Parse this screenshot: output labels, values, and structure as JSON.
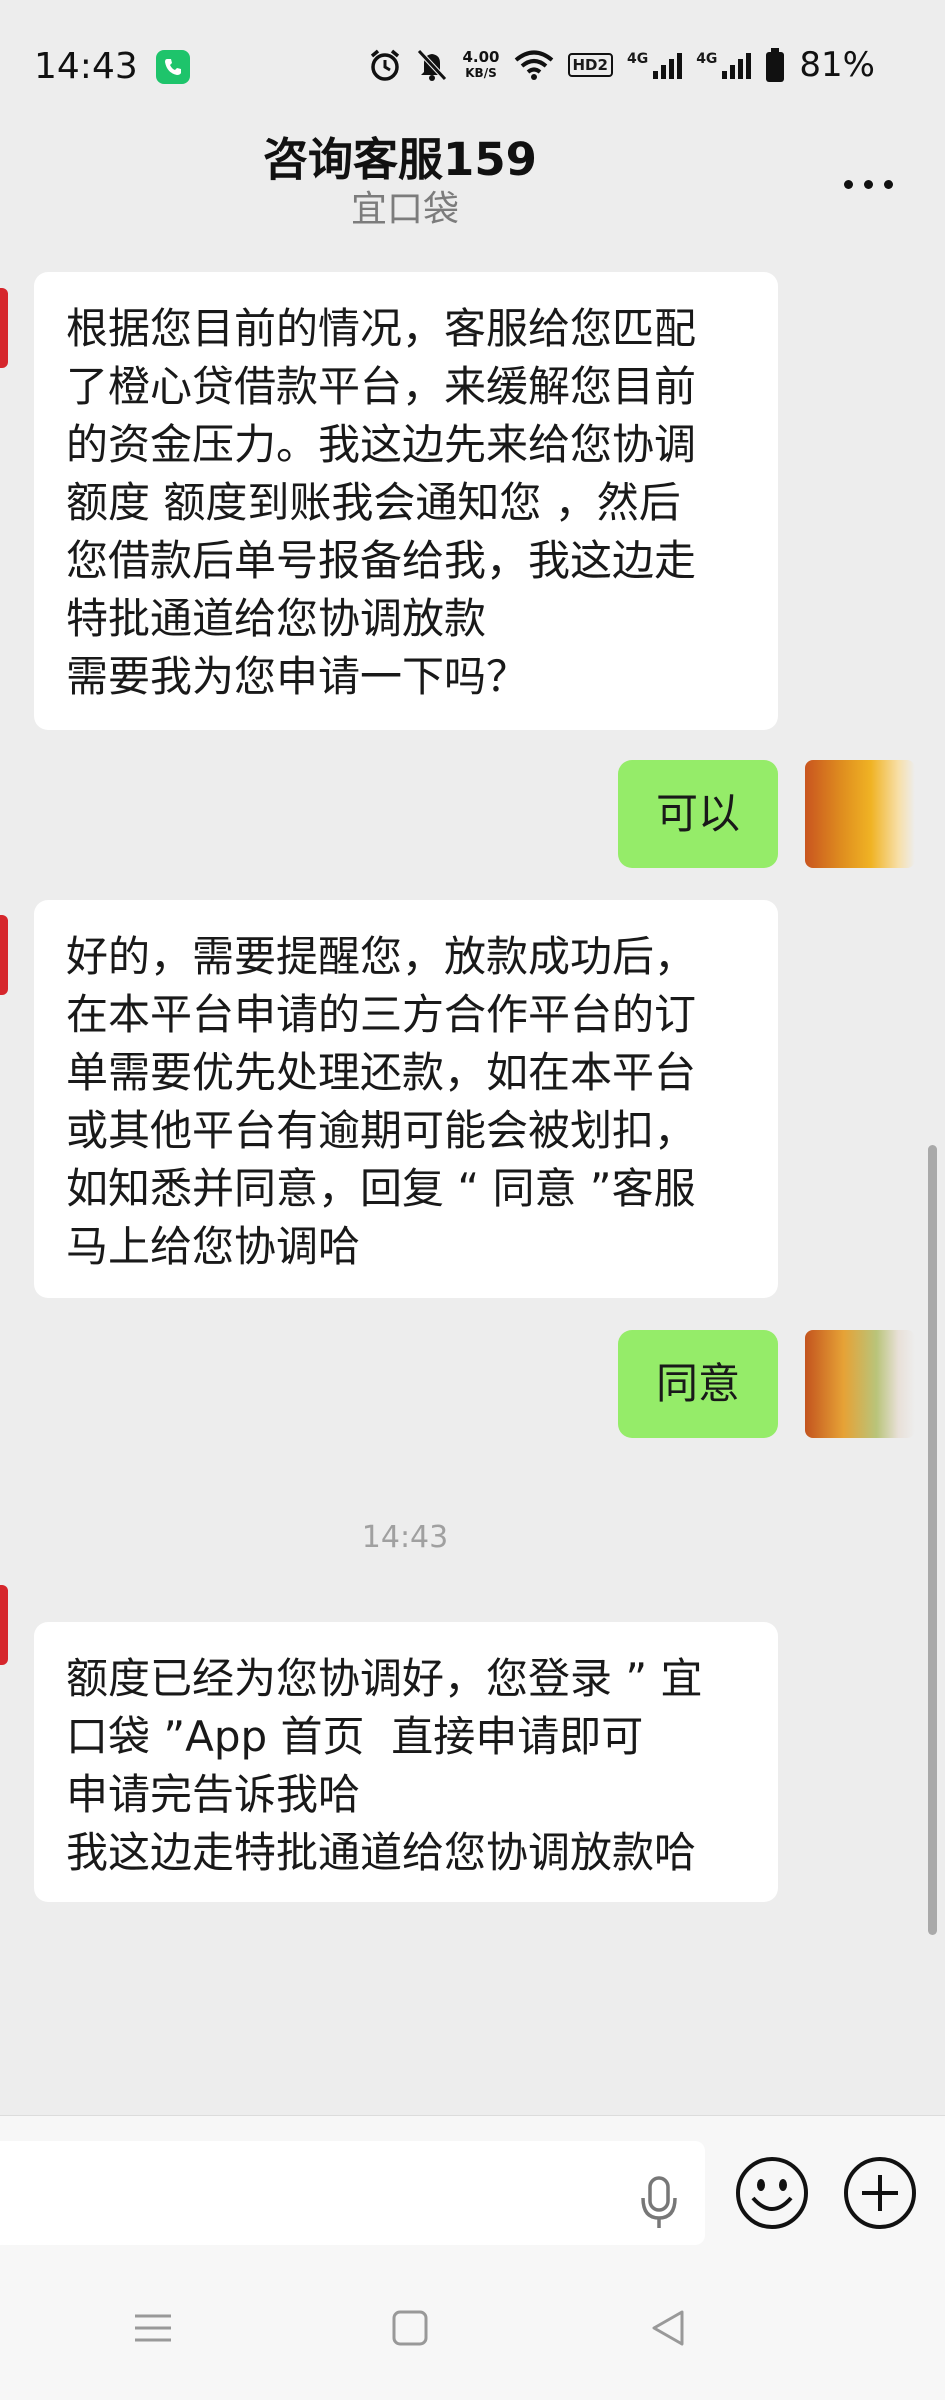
{
  "status_bar": {
    "time": "14:43",
    "speed_value": "4.00",
    "speed_unit": "KB/S",
    "hd": "HD2",
    "net1": "4G",
    "net2": "4G",
    "battery": "81%"
  },
  "header": {
    "title": "咨询客服159",
    "subtitle": "宜口袋"
  },
  "messages": [
    {
      "side": "left",
      "text": "根据您目前的情况，客服给您匹配\n了橙心贷借款平台，来缓解您目前\n的资金压力。我这边先来给您协调\n额度 额度到账我会通知您 ，然后\n您借款后单号报备给我，我这边走\n特批通道给您协调放款\n需要我为您申请一下吗？"
    },
    {
      "side": "right",
      "text": "可以"
    },
    {
      "side": "left",
      "text": "好的，需要提醒您，放款成功后，\n在本平台申请的三方合作平台的订\n单需要优先处理还款，如在本平台\n或其他平台有逾期可能会被划扣，\n如知悉并同意，回复 “ 同意 ”客服\n马上给您协调哈"
    },
    {
      "side": "right",
      "text": "同意"
    },
    {
      "side": "time",
      "text": "14:43"
    },
    {
      "side": "left",
      "text": "额度已经为您协调好，您登录 ” 宜\n口袋 ”App 首页  直接申请即可\n申请完告诉我哈\n我这边走特批通道给您协调放款哈"
    }
  ],
  "colors": {
    "background": "#ededed",
    "bubble_self": "#95ec69",
    "bubble_other": "#ffffff",
    "call_badge": "#1ec46b"
  },
  "icons": [
    "phone-icon",
    "alarm-icon",
    "mute-icon",
    "wifi-icon",
    "battery-icon",
    "more-icon",
    "mic-icon",
    "emoji-icon",
    "plus-icon",
    "menu-icon",
    "home-icon",
    "back-icon"
  ]
}
